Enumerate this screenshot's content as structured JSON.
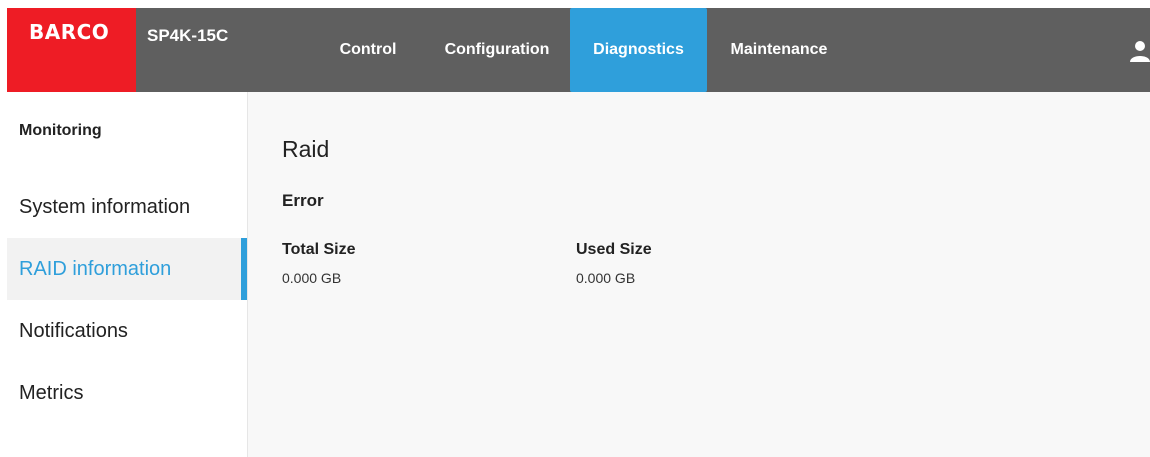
{
  "header": {
    "logo_text": "BARCO",
    "model": "SP4K-15C",
    "tabs": [
      {
        "label": "Control"
      },
      {
        "label": "Configuration"
      },
      {
        "label": "Diagnostics",
        "active": true
      },
      {
        "label": "Maintenance"
      }
    ],
    "user_icon": "user-icon"
  },
  "sidebar": {
    "heading": "Monitoring",
    "items": [
      {
        "label": "System information"
      },
      {
        "label": "RAID information",
        "active": true
      },
      {
        "label": "Notifications"
      },
      {
        "label": "Metrics"
      }
    ]
  },
  "main": {
    "title": "Raid",
    "status": "Error",
    "fields": [
      {
        "label": "Total Size",
        "value": "0.000 GB"
      },
      {
        "label": "Used Size",
        "value": "0.000 GB"
      }
    ]
  },
  "colors": {
    "brand_red": "#ee1c25",
    "header_bg": "#5f5f5f",
    "accent": "#2f9fdb"
  }
}
